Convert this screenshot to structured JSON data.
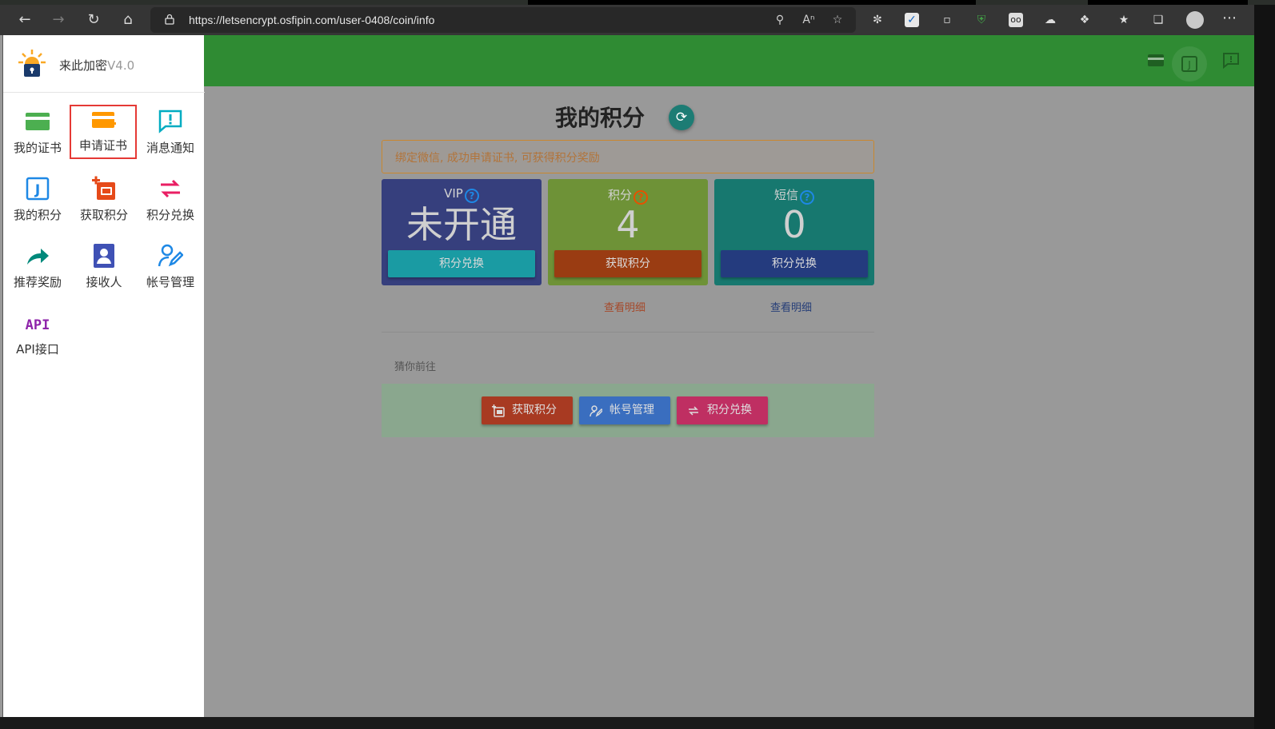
{
  "browser": {
    "url": "https://letsencrypt.osfipin.com/user-0408/coin/info"
  },
  "sidebar": {
    "brand_name": "来此加密",
    "brand_version": "V4.0",
    "items": [
      {
        "label": "我的证书",
        "icon": "certificate-card-icon",
        "color": "#4caf50"
      },
      {
        "label": "申请证书",
        "icon": "add-card-icon",
        "color": "#ff9800",
        "selected": true
      },
      {
        "label": "消息通知",
        "icon": "message-alert-icon",
        "color": "#00acc1"
      },
      {
        "label": "我的积分",
        "icon": "points-j-icon",
        "color": "#1e88e5"
      },
      {
        "label": "获取积分",
        "icon": "add-points-icon",
        "color": "#e64a19"
      },
      {
        "label": "积分兑换",
        "icon": "swap-arrows-icon",
        "color": "#e91e63"
      },
      {
        "label": "推荐奖励",
        "icon": "share-arrow-icon",
        "color": "#00897b"
      },
      {
        "label": "接收人",
        "icon": "contact-card-icon",
        "color": "#3f51b5"
      },
      {
        "label": "帐号管理",
        "icon": "user-edit-icon",
        "color": "#1e88e5"
      },
      {
        "label": "API接口",
        "icon": "api-icon",
        "color": "#8e24aa"
      }
    ]
  },
  "main": {
    "title": "我的积分",
    "notice": "绑定微信, 成功申请证书, 可获得积分奖励",
    "cards": [
      {
        "title": "VIP",
        "value": "未开通",
        "button": "积分兑换",
        "bg": "#363f7d",
        "btn_bg": "#1a9ba3",
        "q_color": "#1e88e5"
      },
      {
        "title": "积分",
        "value": "4",
        "button": "获取积分",
        "bg": "#6e9237",
        "btn_bg": "#9a3c12",
        "q_color": "#e65100"
      },
      {
        "title": "短信",
        "value": "0",
        "button": "积分兑换",
        "bg": "#17786f",
        "btn_bg": "#243b7e",
        "q_color": "#1e88e5"
      }
    ],
    "details": [
      {
        "label": "查看明细",
        "color": "#a5492a"
      },
      {
        "label": "查看明细",
        "color": "#263e78"
      }
    ],
    "guess_label": "猜你前往",
    "quick_buttons": [
      {
        "label": "获取积分",
        "icon": "add-points-icon",
        "bg": "#a83a22"
      },
      {
        "label": "帐号管理",
        "icon": "user-edit-icon",
        "bg": "#3a6ebf"
      },
      {
        "label": "积分兑换",
        "icon": "swap-arrows-icon",
        "bg": "#bf2f62"
      }
    ]
  }
}
